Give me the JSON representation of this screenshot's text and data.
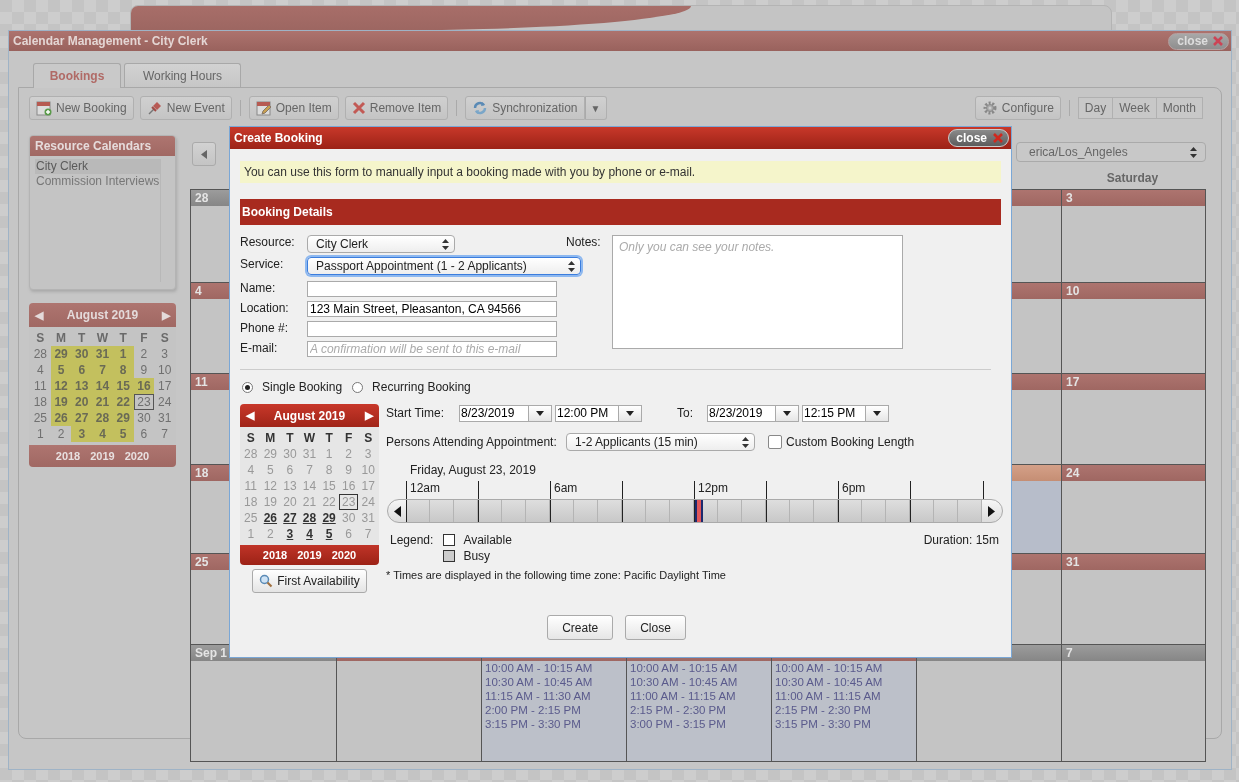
{
  "window": {
    "title": "Calendar Management - City Clerk",
    "close_label": "close"
  },
  "tabs": [
    {
      "label": "Bookings",
      "selected": true
    },
    {
      "label": "Working Hours",
      "selected": false
    }
  ],
  "toolbar": {
    "buttons": [
      {
        "label": "New Booking"
      },
      {
        "label": "New Event"
      },
      {
        "label": "Open Item"
      },
      {
        "label": "Remove Item"
      },
      {
        "label": "Synchronization",
        "dropdown": "▼"
      }
    ],
    "configure": "Configure",
    "views": [
      "Day",
      "Week",
      "Month"
    ]
  },
  "sidebar": {
    "title": "Resource Calendars",
    "items": [
      {
        "label": "City Clerk",
        "selected": true
      },
      {
        "label": "Commission Interviews",
        "selected": false
      }
    ]
  },
  "sidebar_calendar": {
    "prev": "◀",
    "month": "August 2019",
    "next": "▶",
    "weekdays": [
      "S",
      "M",
      "T",
      "W",
      "T",
      "F",
      "S"
    ],
    "years": [
      "2018",
      "2019",
      "2020"
    ],
    "days": [
      {
        "day": "28",
        "available": false,
        "today": false
      },
      {
        "day": "29",
        "available": true,
        "today": false
      },
      {
        "day": "30",
        "available": true,
        "today": false
      },
      {
        "day": "31",
        "available": true,
        "today": false
      },
      {
        "day": "1",
        "available": true,
        "today": false
      },
      {
        "day": "2",
        "available": false,
        "today": false
      },
      {
        "day": "3",
        "available": false,
        "today": false
      },
      {
        "day": "4",
        "available": false,
        "today": false
      },
      {
        "day": "5",
        "available": true,
        "today": false
      },
      {
        "day": "6",
        "available": true,
        "today": false
      },
      {
        "day": "7",
        "available": true,
        "today": false
      },
      {
        "day": "8",
        "available": true,
        "today": false
      },
      {
        "day": "9",
        "available": false,
        "today": false
      },
      {
        "day": "10",
        "available": false,
        "today": false
      },
      {
        "day": "11",
        "available": false,
        "today": false
      },
      {
        "day": "12",
        "available": true,
        "today": false
      },
      {
        "day": "13",
        "available": true,
        "today": false
      },
      {
        "day": "14",
        "available": true,
        "today": false
      },
      {
        "day": "15",
        "available": true,
        "today": false
      },
      {
        "day": "16",
        "available": true,
        "today": false
      },
      {
        "day": "17",
        "available": false,
        "today": false
      },
      {
        "day": "18",
        "available": false,
        "today": false
      },
      {
        "day": "19",
        "available": true,
        "today": false
      },
      {
        "day": "20",
        "available": true,
        "today": false
      },
      {
        "day": "21",
        "available": true,
        "today": false
      },
      {
        "day": "22",
        "available": true,
        "today": false
      },
      {
        "day": "23",
        "available": false,
        "today": true
      },
      {
        "day": "24",
        "available": false,
        "today": false
      },
      {
        "day": "25",
        "available": false,
        "today": false
      },
      {
        "day": "26",
        "available": true,
        "today": false
      },
      {
        "day": "27",
        "available": true,
        "today": false
      },
      {
        "day": "28",
        "available": true,
        "today": false
      },
      {
        "day": "29",
        "available": true,
        "today": false
      },
      {
        "day": "30",
        "available": false,
        "today": false
      },
      {
        "day": "31",
        "available": false,
        "today": false
      },
      {
        "day": "1",
        "available": false,
        "today": false
      },
      {
        "day": "2",
        "available": false,
        "today": false
      },
      {
        "day": "3",
        "available": true,
        "today": false
      },
      {
        "day": "4",
        "available": true,
        "today": false
      },
      {
        "day": "5",
        "available": true,
        "today": false
      },
      {
        "day": "6",
        "available": false,
        "today": false
      },
      {
        "day": "7",
        "available": false,
        "today": false
      }
    ]
  },
  "calendar": {
    "timezone": "erica/Los_Angeles",
    "saturday_header": "Saturday",
    "weeks": [
      {
        "cells": [
          {
            "day": "28",
            "other_month": true
          },
          {},
          {},
          {},
          {},
          {
            "other_month": false,
            "today": false
          },
          {
            "day": "3",
            "other_month": false
          }
        ]
      },
      {
        "cells": [
          {
            "day": "4",
            "other_month": false
          },
          {},
          {},
          {},
          {},
          {
            "other_month": false,
            "today": false
          },
          {
            "day": "10",
            "other_month": false
          }
        ]
      },
      {
        "cells": [
          {
            "day": "11",
            "other_month": false
          },
          {},
          {},
          {},
          {},
          {
            "other_month": false,
            "today": false
          },
          {
            "day": "17",
            "other_month": false
          }
        ]
      },
      {
        "cells": [
          {
            "day": "18",
            "other_month": false
          },
          {},
          {},
          {},
          {},
          {
            "other_month": false,
            "today": true
          },
          {
            "day": "24",
            "other_month": false
          }
        ]
      },
      {
        "cells": [
          {
            "day": "25",
            "other_month": false
          },
          {},
          {},
          {},
          {},
          {
            "other_month": false,
            "today": false
          },
          {
            "day": "31",
            "other_month": false
          }
        ]
      },
      {
        "cells": [
          {
            "day": "Sep 1",
            "other_month": true
          },
          {},
          {
            "slots": [
              "10:00 AM - 10:15 AM",
              "10:30 AM - 10:45 AM",
              "11:15 AM - 11:30 AM",
              "2:00 PM - 2:15 PM",
              "3:15 PM - 3:30 PM"
            ]
          },
          {
            "slots": [
              "10:00 AM - 10:15 AM",
              "10:30 AM - 10:45 AM",
              "11:00 AM - 11:15 AM",
              "2:15 PM - 2:30 PM",
              "3:00 PM - 3:15 PM"
            ]
          },
          {
            "slots": [
              "10:00 AM - 10:15 AM",
              "10:30 AM - 10:45 AM",
              "11:00 AM - 11:15 AM",
              "2:15 PM - 2:30 PM",
              "3:15 PM - 3:30 PM"
            ]
          },
          {
            "other_month": true,
            "today": false
          },
          {
            "day": "7",
            "other_month": true
          }
        ]
      }
    ]
  },
  "dialog": {
    "title": "Create Booking",
    "close_label": "close",
    "info": "You can use this form to manually input a booking made with you by phone or e-mail.",
    "section": "Booking Details",
    "fields": [
      {
        "label": "Resource:",
        "kind": "select",
        "value": "City Clerk",
        "focused": false
      },
      {
        "label": "Service:",
        "kind": "select",
        "value": "Passport Appointment (1 - 2 Applicants)",
        "focused": true
      },
      {
        "label": "Name:",
        "kind": "text",
        "focused": false
      },
      {
        "label": "Location:",
        "kind": "text",
        "value": "123 Main Street, Pleasanton, CA 94566",
        "focused": false
      },
      {
        "label": "Phone #:",
        "kind": "text",
        "focused": false
      },
      {
        "label": "E-mail:",
        "kind": "text",
        "placeholder": "A confirmation will be sent to this e-mail",
        "focused": false
      }
    ],
    "notes": {
      "label": "Notes:",
      "placeholder": "Only you can see your notes."
    },
    "booking_types": [
      {
        "label": "Single Booking",
        "selected": true
      },
      {
        "label": "Recurring Booking",
        "selected": false
      }
    ],
    "calendar": {
      "prev": "◀",
      "month": "August 2019",
      "next": "▶",
      "weekdays": [
        "S",
        "M",
        "T",
        "W",
        "T",
        "F",
        "S"
      ],
      "years": [
        "2018",
        "2019",
        "2020"
      ],
      "days": [
        {
          "day": "28",
          "available": false,
          "today": false
        },
        {
          "day": "29",
          "available": false,
          "today": false
        },
        {
          "day": "30",
          "available": false,
          "today": false
        },
        {
          "day": "31",
          "available": false,
          "today": false
        },
        {
          "day": "1",
          "available": false,
          "today": false
        },
        {
          "day": "2",
          "available": false,
          "today": false
        },
        {
          "day": "3",
          "available": false,
          "today": false
        },
        {
          "day": "4",
          "available": false,
          "today": false
        },
        {
          "day": "5",
          "available": false,
          "today": false
        },
        {
          "day": "6",
          "available": false,
          "today": false
        },
        {
          "day": "7",
          "available": false,
          "today": false
        },
        {
          "day": "8",
          "available": false,
          "today": false
        },
        {
          "day": "9",
          "available": false,
          "today": false
        },
        {
          "day": "10",
          "available": false,
          "today": false
        },
        {
          "day": "11",
          "available": false,
          "today": false
        },
        {
          "day": "12",
          "available": false,
          "today": false
        },
        {
          "day": "13",
          "available": false,
          "today": false
        },
        {
          "day": "14",
          "available": false,
          "today": false
        },
        {
          "day": "15",
          "available": false,
          "today": false
        },
        {
          "day": "16",
          "available": false,
          "today": false
        },
        {
          "day": "17",
          "available": false,
          "today": false
        },
        {
          "day": "18",
          "available": false,
          "today": false
        },
        {
          "day": "19",
          "available": false,
          "today": false
        },
        {
          "day": "20",
          "available": false,
          "today": false
        },
        {
          "day": "21",
          "available": false,
          "today": false
        },
        {
          "day": "22",
          "available": false,
          "today": false
        },
        {
          "day": "23",
          "available": false,
          "today": true
        },
        {
          "day": "24",
          "available": false,
          "today": false
        },
        {
          "day": "25",
          "available": false,
          "today": false
        },
        {
          "day": "26",
          "available": true,
          "today": false
        },
        {
          "day": "27",
          "available": true,
          "today": false
        },
        {
          "day": "28",
          "available": true,
          "today": false
        },
        {
          "day": "29",
          "available": true,
          "today": false
        },
        {
          "day": "30",
          "available": false,
          "today": false
        },
        {
          "day": "31",
          "available": false,
          "today": false
        },
        {
          "day": "1",
          "available": false,
          "today": false
        },
        {
          "day": "2",
          "available": false,
          "today": false
        },
        {
          "day": "3",
          "available": true,
          "today": false
        },
        {
          "day": "4",
          "available": true,
          "today": false
        },
        {
          "day": "5",
          "available": true,
          "today": false
        },
        {
          "day": "6",
          "available": false,
          "today": false
        },
        {
          "day": "7",
          "available": false,
          "today": false
        }
      ]
    },
    "first_availability": "First Availability",
    "start": {
      "label": "Start Time:",
      "date": "8/23/2019",
      "time": "12:00 PM"
    },
    "end": {
      "label": "To:",
      "date": "8/23/2019",
      "time": "12:15 PM"
    },
    "persons": {
      "label": "Persons Attending Appointment:",
      "value": "1-2 Applicants (15 min)"
    },
    "custom_length": {
      "label": "Custom Booking Length",
      "checked": false
    },
    "timeline": {
      "date": "Friday, August 23, 2019",
      "hour_labels": [
        "12am",
        "6am",
        "12pm",
        "6pm"
      ],
      "hours": [
        {
          "selected": false
        },
        {
          "selected": false
        },
        {
          "selected": false
        },
        {
          "selected": false
        },
        {
          "selected": false
        },
        {
          "selected": false
        },
        {
          "selected": false
        },
        {
          "selected": false
        },
        {
          "selected": false
        },
        {
          "selected": false
        },
        {
          "selected": false
        },
        {
          "selected": false
        },
        {
          "selected": true
        },
        {
          "selected": false
        },
        {
          "selected": false
        },
        {
          "selected": false
        },
        {
          "selected": false
        },
        {
          "selected": false
        },
        {
          "selected": false
        },
        {
          "selected": false
        },
        {
          "selected": false
        },
        {
          "selected": false
        },
        {
          "selected": false
        },
        {
          "selected": false
        }
      ]
    },
    "legend": {
      "label": "Legend:",
      "items": [
        {
          "label": "Available",
          "kind": "available"
        },
        {
          "label": "Busy",
          "kind": "busy"
        }
      ]
    },
    "duration": "Duration: 15m",
    "timezone_note": "* Times are displayed in the following time zone: Pacific Daylight Time",
    "buttons": [
      "Create",
      "Close"
    ]
  }
}
